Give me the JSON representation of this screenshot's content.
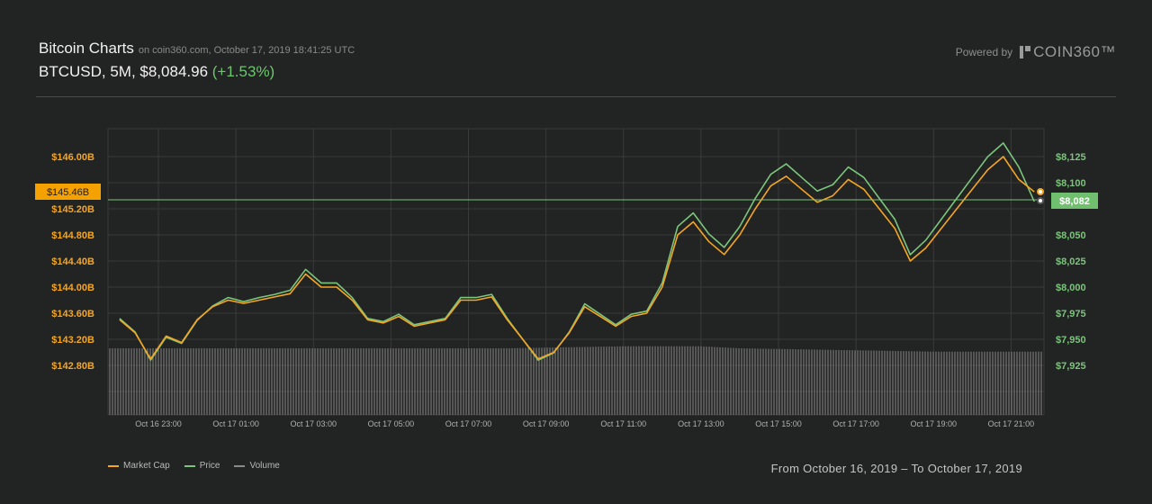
{
  "header": {
    "title": "Bitcoin Charts",
    "subtitle": "on coin360.com, October 17, 2019 18:41:25 UTC",
    "ticker": "BTCUSD, 5M, $8,084.96",
    "change": "(+1.53%)",
    "powered_by": "Powered by",
    "brand": "COIN360™"
  },
  "footer": {
    "legend": [
      {
        "label": "Market Cap",
        "color": "#f5a623"
      },
      {
        "label": "Price",
        "color": "#7bc67b"
      },
      {
        "label": "Volume",
        "color": "#8a8a8a"
      }
    ],
    "range": "From October 16, 2019 – To October 17, 2019"
  },
  "chart_data": {
    "type": "line",
    "colors": {
      "market_cap": "#f5a623",
      "price": "#7bc67b",
      "volume": "#8a8a8a",
      "grid": "#3a3a3a"
    },
    "x_tick_labels": [
      "Oct 16 23:00",
      "Oct 17 01:00",
      "Oct 17 03:00",
      "Oct 17 05:00",
      "Oct 17 07:00",
      "Oct 17 09:00",
      "Oct 17 11:00",
      "Oct 17 13:00",
      "Oct 17 15:00",
      "Oct 17 17:00",
      "Oct 17 19:00",
      "Oct 17 21:00"
    ],
    "x_tick_hours": [
      1,
      3,
      5,
      7,
      9,
      11,
      13,
      15,
      17,
      19,
      21,
      23
    ],
    "x_range_hours": [
      -0.3,
      23.85
    ],
    "y_left": {
      "ticks": [
        142.8,
        143.2,
        143.6,
        144.0,
        144.4,
        144.8,
        145.2,
        146.0
      ],
      "tick_labels": [
        "$142.80B",
        "$143.20B",
        "$143.60B",
        "$144.00B",
        "$144.40B",
        "$144.80B",
        "$145.20B",
        "$146.00B"
      ],
      "current": 145.46,
      "current_label": "$145.46B",
      "unit": "B USD"
    },
    "y_right": {
      "ticks": [
        7925,
        7950,
        7975,
        8000,
        8025,
        8050,
        8100,
        8125
      ],
      "tick_labels": [
        "$7,925",
        "$7,950",
        "$7,975",
        "$8,000",
        "$8,025",
        "$8,050",
        "$8,100",
        "$8,125"
      ],
      "current": 8082,
      "current_label": "$8,082"
    },
    "series": [
      {
        "name": "Market Cap",
        "hours": [
          0,
          0.4,
          0.8,
          1.2,
          1.6,
          2.0,
          2.4,
          2.8,
          3.2,
          3.6,
          4.0,
          4.4,
          4.8,
          5.2,
          5.6,
          6.0,
          6.4,
          6.8,
          7.2,
          7.6,
          8.0,
          8.4,
          8.8,
          9.2,
          9.6,
          10.0,
          10.4,
          10.8,
          11.2,
          11.6,
          12.0,
          12.4,
          12.8,
          13.2,
          13.6,
          14.0,
          14.4,
          14.8,
          15.2,
          15.6,
          16.0,
          16.4,
          16.8,
          17.2,
          17.6,
          18.0,
          18.4,
          18.8,
          19.2,
          19.6,
          20.0,
          20.4,
          20.8,
          21.2,
          21.6,
          22.0,
          22.4,
          22.8,
          23.2,
          23.6
        ],
        "values": [
          143.5,
          143.3,
          142.9,
          143.25,
          143.15,
          143.5,
          143.7,
          143.8,
          143.75,
          143.8,
          143.85,
          143.9,
          144.2,
          144.0,
          144.0,
          143.8,
          143.5,
          143.45,
          143.55,
          143.4,
          143.45,
          143.5,
          143.8,
          143.8,
          143.85,
          143.5,
          143.2,
          142.9,
          143.0,
          143.3,
          143.7,
          143.55,
          143.4,
          143.55,
          143.6,
          144.0,
          144.8,
          145.0,
          144.7,
          144.5,
          144.8,
          145.2,
          145.55,
          145.7,
          145.5,
          145.3,
          145.4,
          145.65,
          145.5,
          145.2,
          144.9,
          144.4,
          144.6,
          144.9,
          145.2,
          145.5,
          145.8,
          146.0,
          145.65,
          145.46
        ]
      },
      {
        "name": "Price",
        "hours": [
          0,
          0.4,
          0.8,
          1.2,
          1.6,
          2.0,
          2.4,
          2.8,
          3.2,
          3.6,
          4.0,
          4.4,
          4.8,
          5.2,
          5.6,
          6.0,
          6.4,
          6.8,
          7.2,
          7.6,
          8.0,
          8.4,
          8.8,
          9.2,
          9.6,
          10.0,
          10.4,
          10.8,
          11.2,
          11.6,
          12.0,
          12.4,
          12.8,
          13.2,
          13.6,
          14.0,
          14.4,
          14.8,
          15.2,
          15.6,
          16.0,
          16.4,
          16.8,
          17.2,
          17.6,
          18.0,
          18.4,
          18.8,
          19.2,
          19.6,
          20.0,
          20.4,
          20.8,
          21.2,
          21.6,
          22.0,
          22.4,
          22.8,
          23.2,
          23.6
        ],
        "values": [
          7970,
          7957,
          7930,
          7952,
          7946,
          7968,
          7982,
          7990,
          7986,
          7990,
          7993,
          7997,
          8017,
          8004,
          8004,
          7990,
          7970,
          7967,
          7974,
          7964,
          7967,
          7970,
          7990,
          7990,
          7993,
          7970,
          7950,
          7930,
          7937,
          7957,
          7984,
          7974,
          7964,
          7974,
          7977,
          8004,
          8058,
          8071,
          8051,
          8038,
          8058,
          8085,
          8108,
          8118,
          8105,
          8092,
          8098,
          8115,
          8105,
          8085,
          8065,
          8031,
          8045,
          8065,
          8085,
          8105,
          8125,
          8138,
          8115,
          8082
        ]
      },
      {
        "name": "Volume",
        "hours": [
          0,
          1,
          2,
          3,
          4,
          5,
          6,
          7,
          8,
          9,
          10,
          11,
          12,
          13,
          14,
          15,
          16,
          17,
          18,
          19,
          20,
          21,
          22,
          23
        ],
        "values": [
          1.0,
          1.0,
          1.0,
          1.0,
          1.0,
          1.0,
          1.0,
          1.0,
          1.0,
          1.0,
          1.0,
          1.01,
          1.02,
          1.03,
          1.03,
          1.03,
          1.0,
          0.99,
          0.98,
          0.97,
          0.96,
          0.95,
          0.95,
          0.95
        ]
      }
    ]
  }
}
